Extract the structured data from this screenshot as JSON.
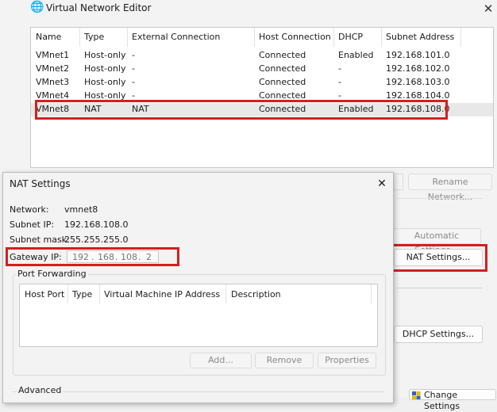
{
  "vne": {
    "title": "Virtual Network Editor",
    "icon": "globe-icon",
    "columns": [
      "Name",
      "Type",
      "External Connection",
      "Host Connection",
      "DHCP",
      "Subnet Address"
    ],
    "rows": [
      {
        "name": "VMnet1",
        "type": "Host-only",
        "ext": "-",
        "host": "Connected",
        "dhcp": "Enabled",
        "subnet": "192.168.101.0"
      },
      {
        "name": "VMnet2",
        "type": "Host-only",
        "ext": "-",
        "host": "Connected",
        "dhcp": "-",
        "subnet": "192.168.102.0"
      },
      {
        "name": "VMnet3",
        "type": "Host-only",
        "ext": "-",
        "host": "Connected",
        "dhcp": "-",
        "subnet": "192.168.103.0"
      },
      {
        "name": "VMnet4",
        "type": "Host-only",
        "ext": "-",
        "host": "Connected",
        "dhcp": "-",
        "subnet": "192.168.104.0"
      },
      {
        "name": "VMnet8",
        "type": "NAT",
        "ext": "NAT",
        "host": "Connected",
        "dhcp": "Enabled",
        "subnet": "192.168.108.0"
      }
    ],
    "buttons": {
      "rename": "Rename Network...",
      "auto": "Automatic Settings...",
      "nat": "NAT Settings...",
      "dhcp": "DHCP Settings...",
      "change": "Change Settings"
    }
  },
  "nat": {
    "title": "NAT Settings",
    "network_label": "Network:",
    "network_value": "vmnet8",
    "subnet_ip_label": "Subnet IP:",
    "subnet_ip_value": "192.168.108.0",
    "subnet_mask_label": "Subnet mask:",
    "subnet_mask_value": "255.255.255.0",
    "gateway_label": "Gateway IP:",
    "gateway_octets": [
      "192",
      "168",
      "108",
      "2"
    ],
    "gateway_dots": [
      ".",
      ".",
      "."
    ],
    "port_forwarding": "Port Forwarding",
    "pf_columns": [
      "Host Port",
      "Type",
      "Virtual Machine IP Address",
      "Description"
    ],
    "buttons": {
      "add": "Add...",
      "remove": "Remove",
      "properties": "Properties"
    },
    "advanced": "Advanced"
  },
  "colors": {
    "highlight": "#d31f1f",
    "accent": "#2a66b8"
  }
}
